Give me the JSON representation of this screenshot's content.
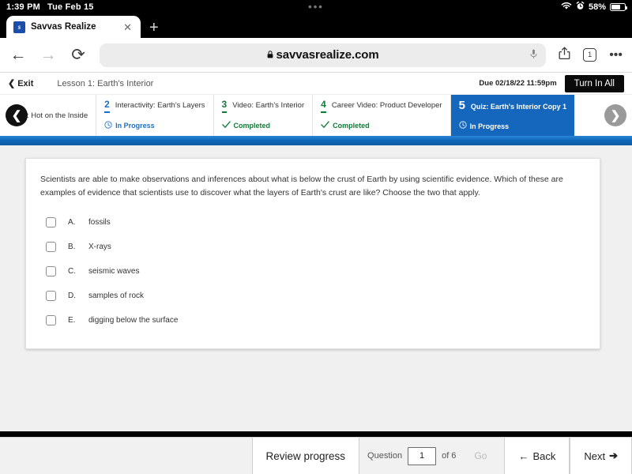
{
  "status_bar": {
    "time": "1:39 PM",
    "date": "Tue Feb 15",
    "dots": "•••",
    "wifi_icon": "wifi-icon",
    "alarm_icon": "alarm-icon",
    "battery_percent": "58%"
  },
  "browser": {
    "tab": {
      "favicon_letter": "s",
      "title": "Savvas Realize",
      "close_label": "✕"
    },
    "new_tab_label": "+",
    "back_icon": "←",
    "forward_icon": "→",
    "reload_icon": "⟳",
    "lock_icon": "🔒",
    "url": "savvasrealize.com",
    "mic_icon": "mic-icon",
    "share_icon": "share-icon",
    "tab_count": "1",
    "more_icon": "•••"
  },
  "lesson_header": {
    "exit_label": "Exit",
    "exit_chevron": "❮",
    "title": "Lesson 1: Earth's Interior",
    "due": "Due 02/18/22 11:59pm",
    "turn_in_label": "Turn In All"
  },
  "steps": {
    "prev_arrow": "❮",
    "next_arrow": "❯",
    "items": [
      {
        "num": "",
        "label": ": Hot on the Inside",
        "status": "",
        "status_icon": "",
        "state": "partial"
      },
      {
        "num": "2",
        "label": "Interactivity: Earth's Layers",
        "status": "In Progress",
        "status_icon": "clock-icon",
        "state": "in-progress"
      },
      {
        "num": "3",
        "label": "Video: Earth's Interior",
        "status": "Completed",
        "status_icon": "check-icon",
        "state": "completed"
      },
      {
        "num": "4",
        "label": "Career Video: Product Developer",
        "status": "Completed",
        "status_icon": "check-icon",
        "state": "completed"
      },
      {
        "num": "5",
        "label": "Quiz: Earth's Interior Copy 1",
        "status": "In Progress",
        "status_icon": "clock-icon",
        "state": "active"
      }
    ]
  },
  "question": {
    "text": "Scientists are able to make observations and inferences about what is below the crust of Earth by using scientific evidence. Which of these are examples of evidence that scientists use to discover what the layers of Earth's crust are like? Choose the two that apply.",
    "choices": [
      {
        "letter": "A.",
        "label": "fossils",
        "checked": false
      },
      {
        "letter": "B.",
        "label": "X-rays",
        "checked": false
      },
      {
        "letter": "C.",
        "label": "seismic waves",
        "checked": false
      },
      {
        "letter": "D.",
        "label": "samples of rock",
        "checked": false
      },
      {
        "letter": "E.",
        "label": "digging below the surface",
        "checked": false
      }
    ]
  },
  "bottom_bar": {
    "review_label": "Review progress",
    "question_label": "Question",
    "question_value": "1",
    "of_label": "of 6",
    "go_label": "Go",
    "back_label": "Back",
    "back_arrow": "←",
    "next_label": "Next",
    "next_arrow": "➔"
  },
  "colors": {
    "accent_blue": "#1567bd",
    "progress_blue": "#1169b8",
    "completed_green": "#117a37",
    "in_progress_blue": "#1c6fc9"
  }
}
